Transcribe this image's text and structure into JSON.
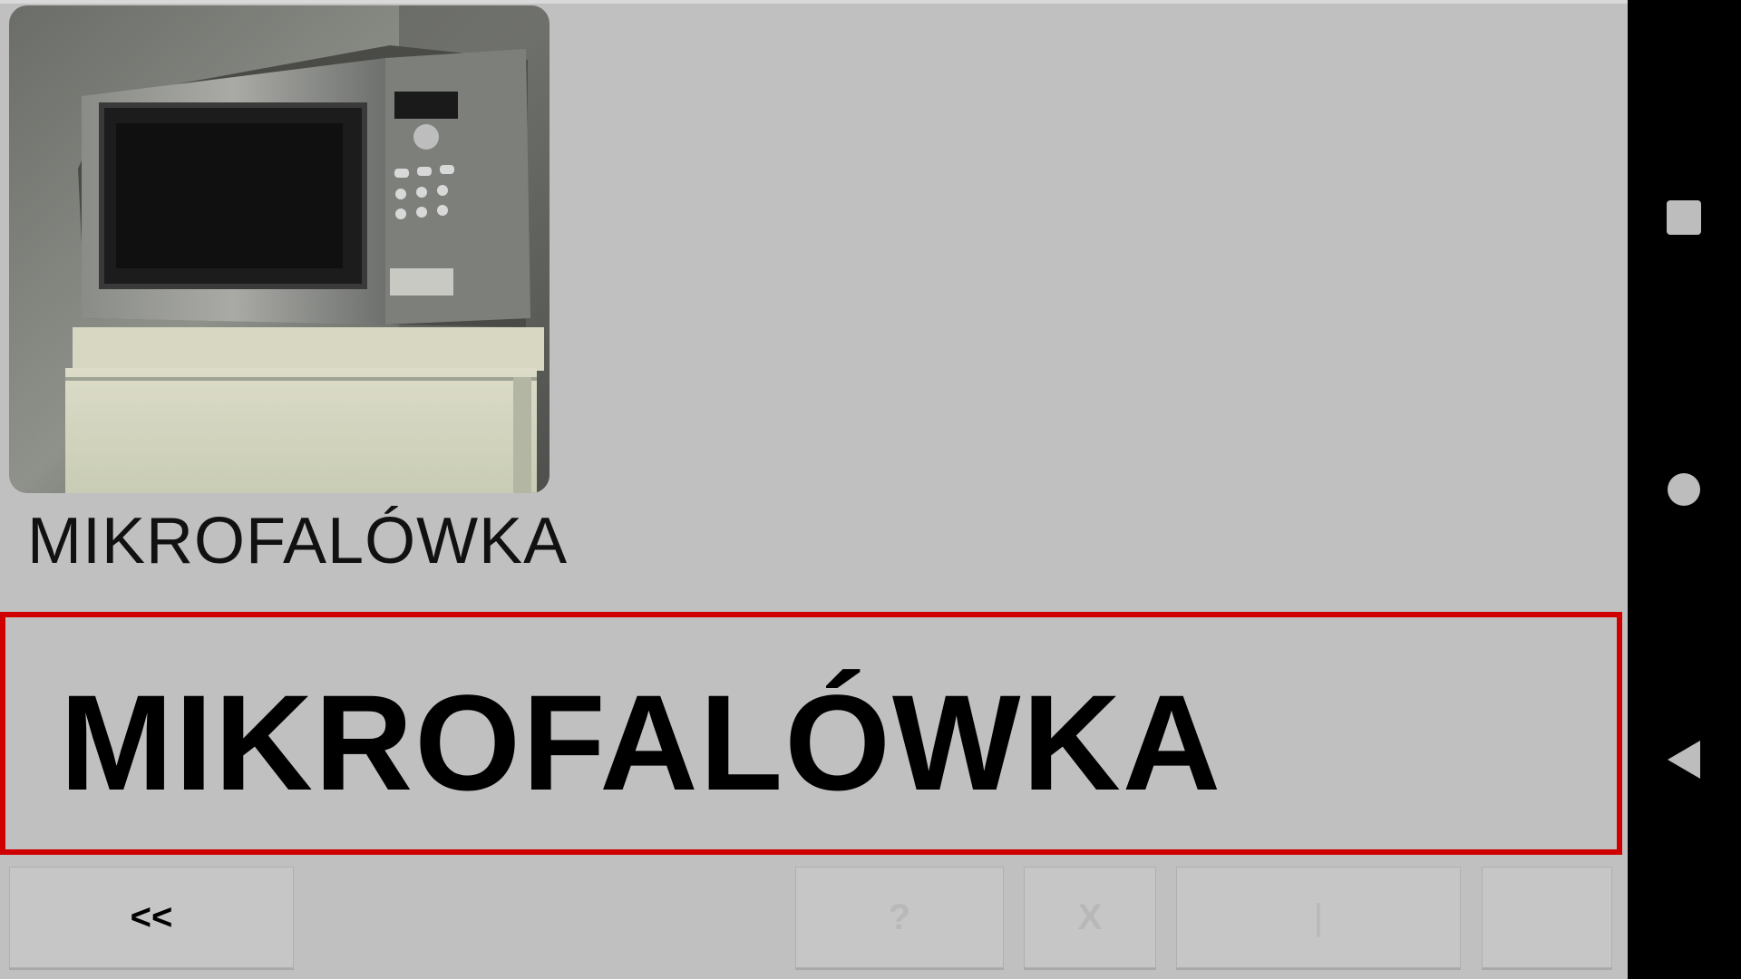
{
  "tile": {
    "image_icon": "microwave-photo",
    "label": "MIKROFALÓWKA"
  },
  "sentence": {
    "text": "MIKROFALÓWKA",
    "border_color": "#d00000"
  },
  "buttons": {
    "back_label": "<<",
    "help_label": "?",
    "clear_label": "X",
    "separator_label": "|",
    "last_label": ""
  },
  "navbar": {
    "recent_icon": "square-icon",
    "home_icon": "circle-icon",
    "back_icon": "triangle-back-icon"
  }
}
